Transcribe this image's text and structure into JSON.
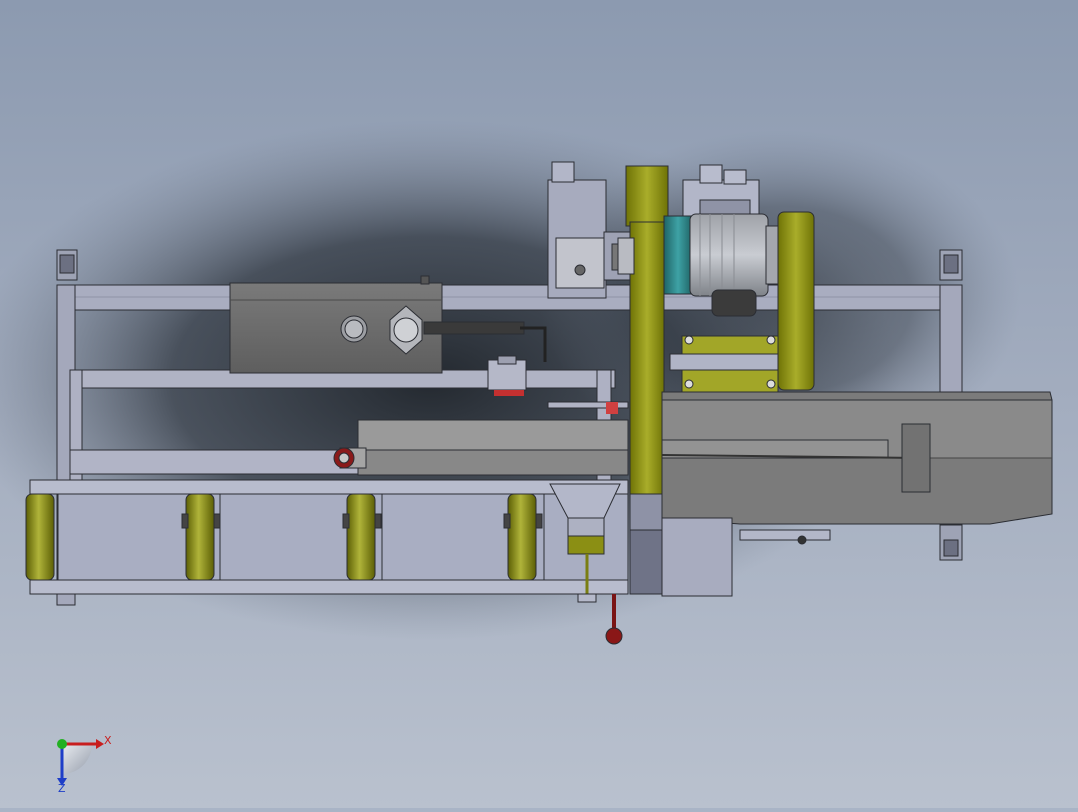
{
  "view": {
    "background_top": "#8e9cb2",
    "background_bottom": "#b6bfcd",
    "shadow_color": "#2a3038",
    "frame_color": "#a8acbf",
    "frame_stroke": "#2b2d33",
    "olive_color": "#868a12",
    "dark_body_color": "#6b6b6b",
    "teal_color": "#2f7f82",
    "handle_red": "#8a1717"
  },
  "triad": {
    "x_label": "X",
    "z_label": "Z",
    "x_color": "#c81e1e",
    "z_color": "#1e3ec8",
    "y_color": "#22b022"
  }
}
